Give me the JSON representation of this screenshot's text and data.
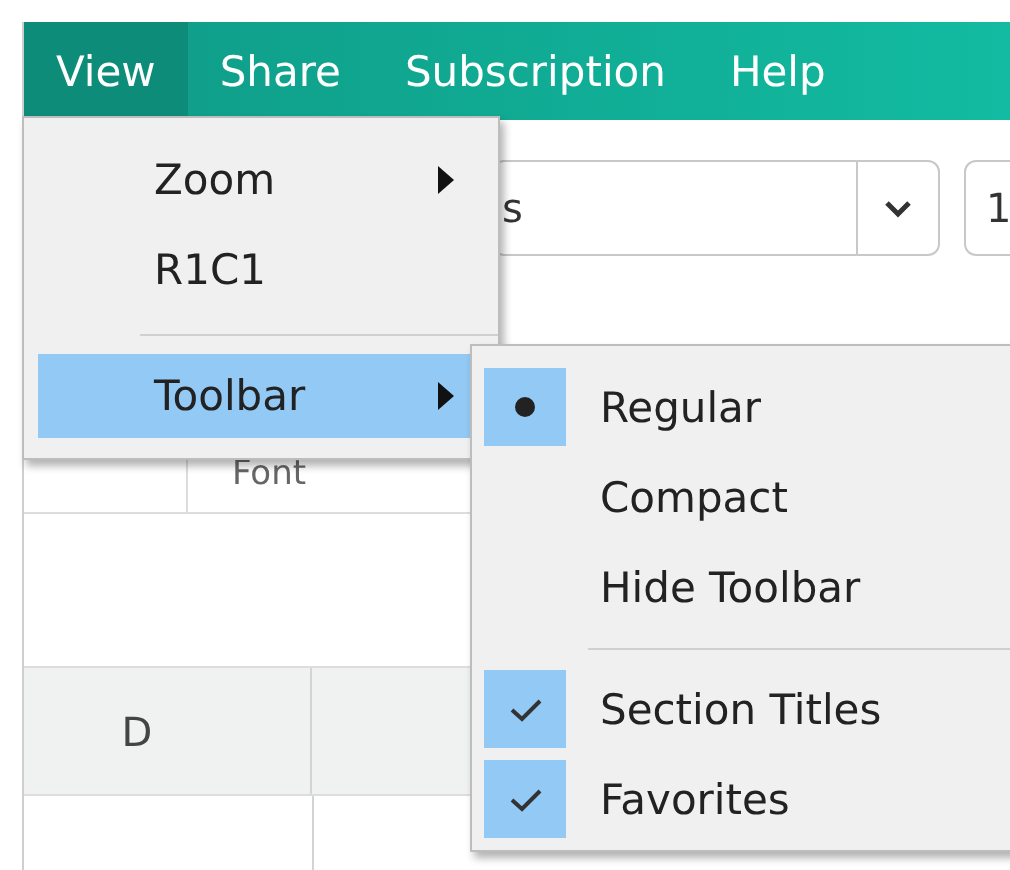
{
  "menubar": [
    {
      "label": "View",
      "selected": true
    },
    {
      "label": "Share",
      "selected": false
    },
    {
      "label": "Subscription",
      "selected": false
    },
    {
      "label": "Help",
      "selected": false
    }
  ],
  "toolbar": {
    "font_field": {
      "value": "s"
    },
    "size_field": {
      "value": "1"
    },
    "section_label": "Font"
  },
  "grid": {
    "column_headers": [
      "D"
    ]
  },
  "view_menu": {
    "items": [
      {
        "kind": "submenu",
        "label": "Zoom",
        "selected": false
      },
      {
        "kind": "item",
        "label": "R1C1",
        "selected": false
      },
      {
        "kind": "separator"
      },
      {
        "kind": "submenu",
        "label": "Toolbar",
        "selected": true
      }
    ]
  },
  "toolbar_menu": {
    "items": [
      {
        "kind": "radio",
        "label": "Regular",
        "checked": true
      },
      {
        "kind": "radio",
        "label": "Compact",
        "checked": false
      },
      {
        "kind": "radio",
        "label": "Hide Toolbar",
        "checked": false
      },
      {
        "kind": "separator"
      },
      {
        "kind": "check",
        "label": "Section Titles",
        "checked": true
      },
      {
        "kind": "check",
        "label": "Favorites",
        "checked": true
      }
    ]
  }
}
